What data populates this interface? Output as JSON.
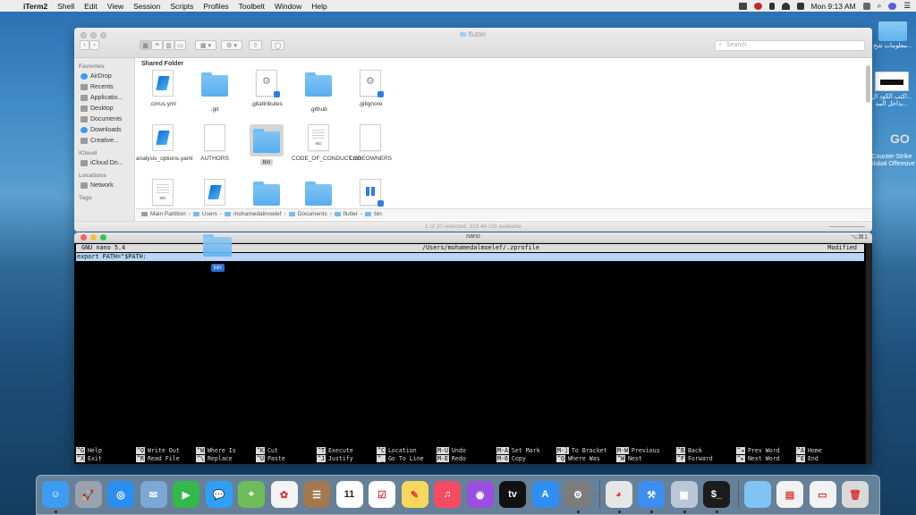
{
  "menubar": {
    "apple": "",
    "app": "iTerm2",
    "items": [
      "Shell",
      "Edit",
      "View",
      "Session",
      "Scripts",
      "Profiles",
      "Toolbelt",
      "Window",
      "Help"
    ],
    "clock": "Mon 9:13 AM"
  },
  "desktop": {
    "item1": "معلومات شخ...",
    "item2_line1": "اكتب الكود ال...",
    "item2_line2": "بداخل المه...",
    "item3_line1": "Counter-Strike",
    "item3_line2": "Global Offensive",
    "go_label": "GO"
  },
  "finder": {
    "title": "flutter",
    "search_placeholder": "Search",
    "content_header": "Shared Folder",
    "sidebar": [
      {
        "type": "head",
        "label": "Favorites"
      },
      {
        "type": "item",
        "label": "AirDrop",
        "icon": "airdrop-icon"
      },
      {
        "type": "item",
        "label": "Recents",
        "icon": "clock-icon"
      },
      {
        "type": "item",
        "label": "Applicatio...",
        "icon": "applications-icon"
      },
      {
        "type": "item",
        "label": "Desktop",
        "icon": "desktop-icon"
      },
      {
        "type": "item",
        "label": "Documents",
        "icon": "documents-icon"
      },
      {
        "type": "item",
        "label": "Downloads",
        "icon": "downloads-icon"
      },
      {
        "type": "item",
        "label": "Creative...",
        "icon": "folder-icon"
      },
      {
        "type": "head",
        "label": "iCloud"
      },
      {
        "type": "item",
        "label": "iCloud Dri...",
        "icon": "cloud-icon"
      },
      {
        "type": "head",
        "label": "Locations"
      },
      {
        "type": "item",
        "label": "Network",
        "icon": "network-icon"
      },
      {
        "type": "head",
        "label": "Tags"
      }
    ],
    "files": [
      {
        "name": ".cirrus.yml",
        "kind": "dart"
      },
      {
        "name": ".git",
        "kind": "folder"
      },
      {
        "name": ".gitattributes",
        "kind": "gear"
      },
      {
        "name": ".github",
        "kind": "folder"
      },
      {
        "name": ".gitignore",
        "kind": "gear"
      },
      {
        "name": "analysis_options.yaml",
        "kind": "dart"
      },
      {
        "name": "AUTHORS",
        "kind": "doc"
      },
      {
        "name": "bin",
        "kind": "folder",
        "selected": true
      },
      {
        "name": "CODE_OF_CONDUCT.md",
        "kind": "md"
      },
      {
        "name": "CODEOWNERS",
        "kind": "doc"
      },
      {
        "name": "",
        "kind": "md"
      },
      {
        "name": "",
        "kind": "dart"
      },
      {
        "name": "",
        "kind": "folder"
      },
      {
        "name": "",
        "kind": "folder"
      },
      {
        "name": "",
        "kind": "win"
      }
    ],
    "path": [
      "Main Partition",
      "Users",
      "mohamedalmoelef",
      "Documents",
      "flutter",
      "bin"
    ],
    "status": "1 of 20 selected, 329.46 GB available"
  },
  "terminal": {
    "title": "nano",
    "shortcut": "⌥⌘1",
    "nano_version": "GNU nano 5.4",
    "file_path": "/Users/mohamedalmoelef/.zprofile",
    "state": "Modified",
    "line1": "export PATH=\"$PATH:",
    "shortcuts": [
      {
        "k1": "^G",
        "t1": "Help",
        "k2": "^X",
        "t2": "Exit"
      },
      {
        "k1": "^O",
        "t1": "Write Out",
        "k2": "^R",
        "t2": "Read File"
      },
      {
        "k1": "^W",
        "t1": "Where Is",
        "k2": "^\\",
        "t2": "Replace"
      },
      {
        "k1": "^K",
        "t1": "Cut",
        "k2": "^U",
        "t2": "Paste"
      },
      {
        "k1": "^T",
        "t1": "Execute",
        "k2": "^J",
        "t2": "Justify"
      },
      {
        "k1": "^C",
        "t1": "Location",
        "k2": "^_",
        "t2": "Go To Line"
      },
      {
        "k1": "M-U",
        "t1": "Undo",
        "k2": "M-E",
        "t2": "Redo"
      },
      {
        "k1": "M-A",
        "t1": "Set Mark",
        "k2": "M-6",
        "t2": "Copy"
      },
      {
        "k1": "M-]",
        "t1": "To Bracket",
        "k2": "^Q",
        "t2": "Where Was"
      },
      {
        "k1": "M-W",
        "t1": "Previous",
        "k2": "^W",
        "t2": "Next"
      },
      {
        "k1": "^B",
        "t1": "Back",
        "k2": "^F",
        "t2": "Forward"
      },
      {
        "k1": "^◂",
        "t1": "Prev Word",
        "k2": "^▸",
        "t2": "Next Word"
      },
      {
        "k1": "^A",
        "t1": "Home",
        "k2": "^E",
        "t2": "End"
      }
    ]
  },
  "drag": {
    "label": "bin"
  },
  "dock": {
    "apps": [
      {
        "name": "finder-icon",
        "color": "#3d9bf2",
        "glyph": "☺"
      },
      {
        "name": "launchpad-icon",
        "color": "#9aa3ad",
        "glyph": "🚀"
      },
      {
        "name": "safari-icon",
        "color": "#2a8ef0",
        "glyph": "◎"
      },
      {
        "name": "mail-stamp-icon",
        "color": "#7da7d6",
        "glyph": "✉"
      },
      {
        "name": "facetime-icon",
        "color": "#35b84a",
        "glyph": "▶"
      },
      {
        "name": "messages-icon",
        "color": "#2fa0f5",
        "glyph": "💬"
      },
      {
        "name": "maps-icon",
        "color": "#6ebd5a",
        "glyph": "⌖"
      },
      {
        "name": "photos-icon",
        "color": "#f3f3f3",
        "glyph": "✿"
      },
      {
        "name": "contacts-icon",
        "color": "#a3784e",
        "glyph": "☰"
      },
      {
        "name": "calendar-icon",
        "color": "#ffffff",
        "glyph": "11"
      },
      {
        "name": "reminders-icon",
        "color": "#ffffff",
        "glyph": "☑"
      },
      {
        "name": "notes-icon",
        "color": "#f7d85c",
        "glyph": "✎"
      },
      {
        "name": "music-icon",
        "color": "#f54b63",
        "glyph": "♫"
      },
      {
        "name": "podcasts-icon",
        "color": "#9b4fe0",
        "glyph": "◉"
      },
      {
        "name": "tv-icon",
        "color": "#111111",
        "glyph": "tv"
      },
      {
        "name": "app-store-icon",
        "color": "#2e8ff2",
        "glyph": "A"
      },
      {
        "name": "system-preferences-icon",
        "color": "#7c7c7c",
        "glyph": "⚙"
      },
      {
        "name": "chrome-icon",
        "color": "#e6e6e6",
        "glyph": "◕"
      },
      {
        "name": "xcode-icon",
        "color": "#3c8ef0",
        "glyph": "⚒"
      },
      {
        "name": "preview-icon",
        "color": "#b9c7d8",
        "glyph": "▣"
      },
      {
        "name": "terminal-icon",
        "color": "#1c1c1c",
        "glyph": "$_"
      },
      {
        "name": "downloads-folder-icon",
        "color": "#7fc4f4",
        "glyph": ""
      },
      {
        "name": "document-stack-icon",
        "color": "#f2f2f2",
        "glyph": "▤"
      },
      {
        "name": "window-stack-icon",
        "color": "#f2f2f2",
        "glyph": "▭"
      },
      {
        "name": "trash-icon",
        "color": "#d9d9d9",
        "glyph": "🗑"
      }
    ]
  }
}
